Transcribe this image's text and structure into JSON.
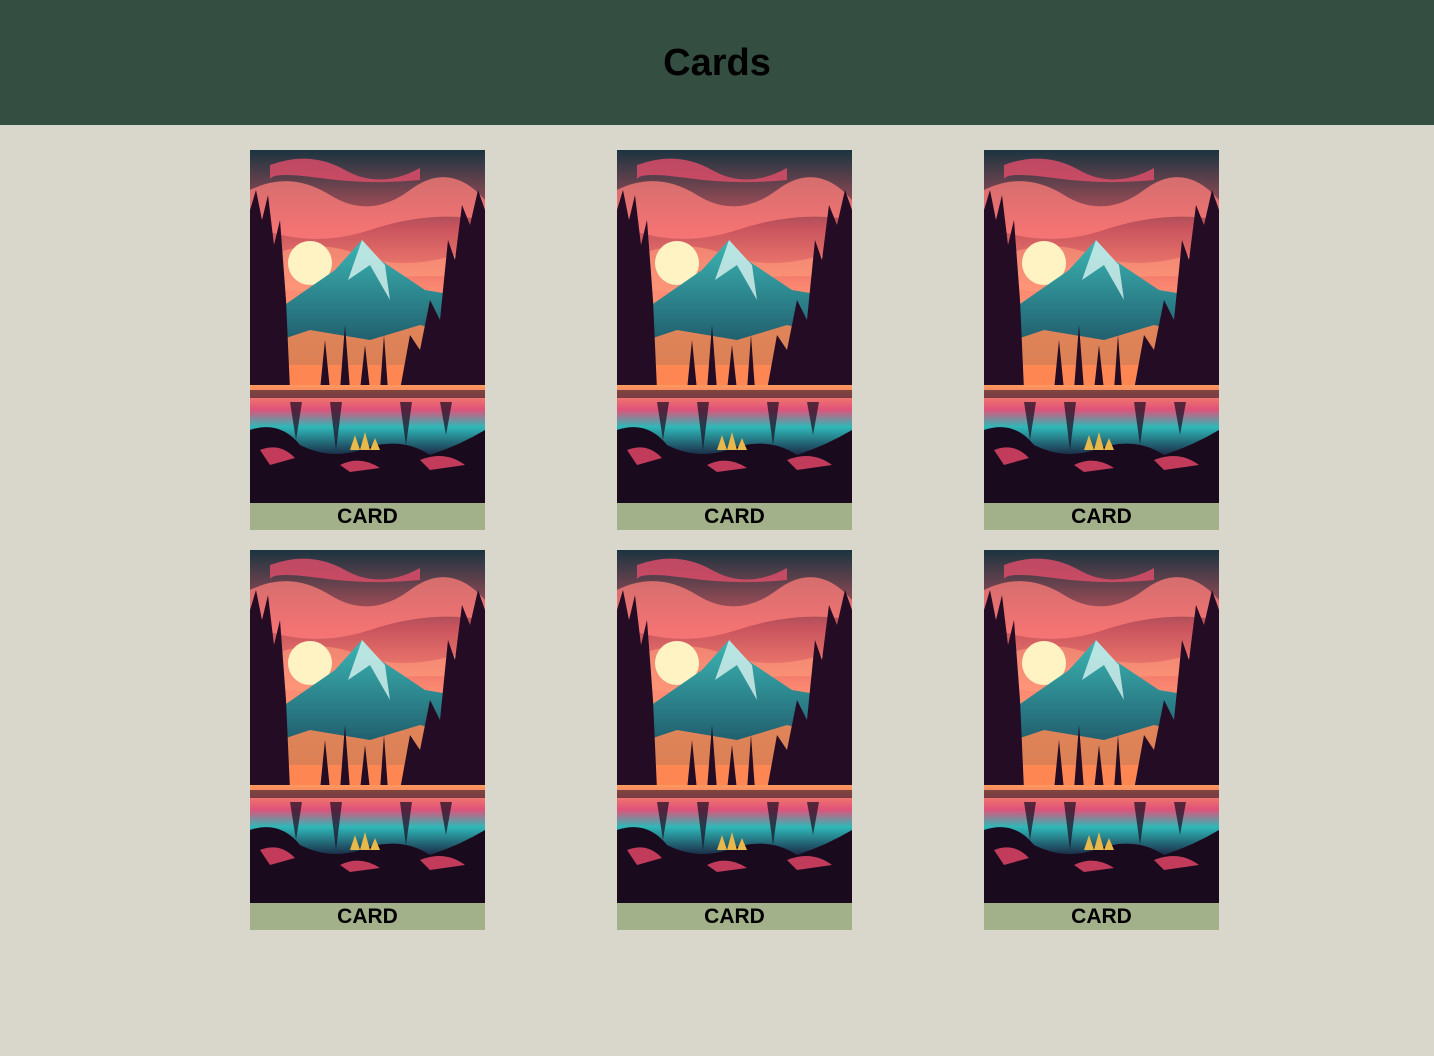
{
  "header": {
    "title": "Cards"
  },
  "colors": {
    "header_bg": "#344e41",
    "page_bg": "#d9d7cb",
    "label_bg": "#a3b18a"
  },
  "cards": [
    {
      "label": "CARD",
      "image": "mountain-lake-sunset-illustration"
    },
    {
      "label": "CARD",
      "image": "mountain-lake-sunset-illustration"
    },
    {
      "label": "CARD",
      "image": "mountain-lake-sunset-illustration"
    },
    {
      "label": "CARD",
      "image": "mountain-lake-sunset-illustration"
    },
    {
      "label": "CARD",
      "image": "mountain-lake-sunset-illustration"
    },
    {
      "label": "CARD",
      "image": "mountain-lake-sunset-illustration"
    }
  ]
}
